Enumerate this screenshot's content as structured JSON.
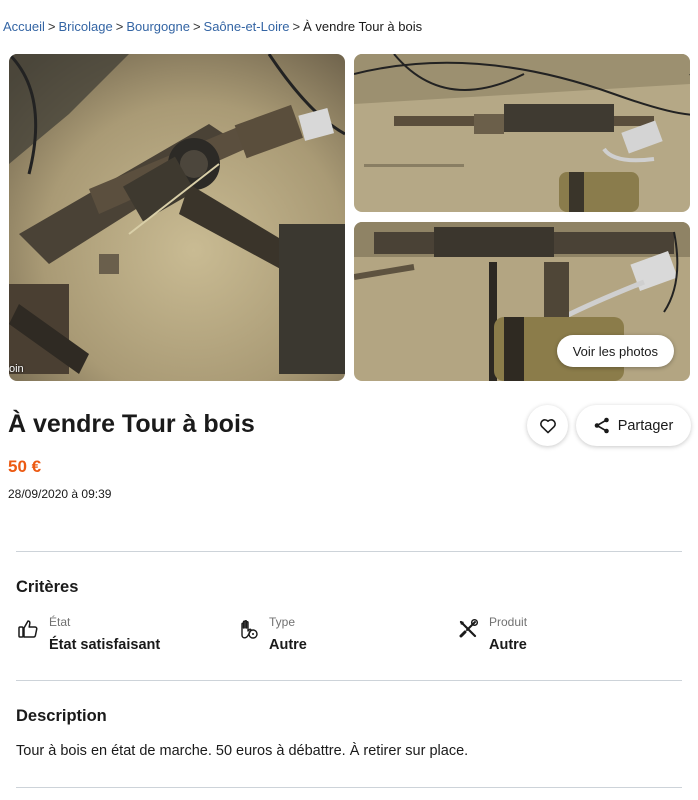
{
  "breadcrumb": {
    "items": [
      "Accueil",
      "Bricolage",
      "Bourgogne",
      "Saône-et-Loire"
    ],
    "current": "À vendre Tour à bois",
    "separator": ">"
  },
  "gallery": {
    "main_tag": "oin",
    "see_photos_label": "Voir les photos"
  },
  "listing": {
    "title": "À vendre Tour à bois",
    "price": "50 €",
    "date": "28/09/2020 à 09:39",
    "share_label": "Partager"
  },
  "criteria": {
    "heading": "Critères",
    "items": [
      {
        "label": "État",
        "value": "État satisfaisant",
        "icon": "thumbs-up-icon"
      },
      {
        "label": "Type",
        "value": "Autre",
        "icon": "hand-tag-icon"
      },
      {
        "label": "Produit",
        "value": "Autre",
        "icon": "tools-icon"
      }
    ]
  },
  "description": {
    "heading": "Description",
    "text": "Tour à bois en état de marche. 50 euros à débattre. À retirer sur place."
  },
  "colors": {
    "link": "#3465a4",
    "price": "#ec5a13",
    "divider": "#cdd3d9"
  }
}
